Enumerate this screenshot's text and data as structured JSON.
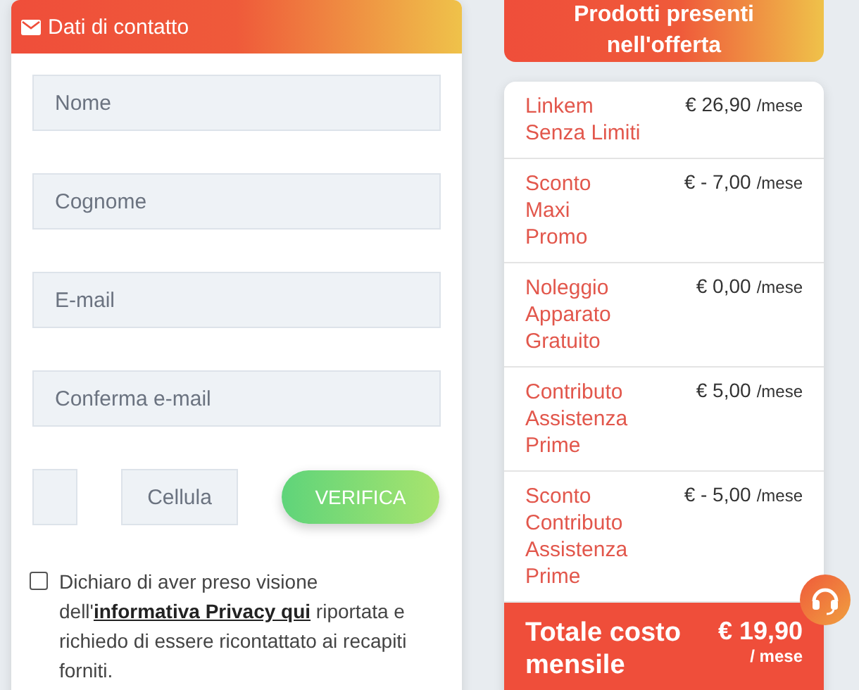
{
  "contact_form": {
    "title": "Dati di contatto",
    "fields": [
      {
        "placeholder": "Nome"
      },
      {
        "placeholder": "Cognome"
      },
      {
        "placeholder": "E-mail"
      },
      {
        "placeholder": "Conferma e-mail"
      }
    ],
    "phone": {
      "number_placeholder": "Cellula",
      "verify_button": "VERIFICA"
    },
    "consent": {
      "checked": false,
      "before": "Dichiaro di aver preso visione dell'",
      "link": "informativa Privacy qui",
      "after": " riportata e richiedo di essere ricontattato ai recapiti forniti."
    }
  },
  "offer": {
    "title": "Prodotti presenti\nnell'offerta",
    "items": [
      {
        "name": "Linkem\nSenza Limiti",
        "price": "€ 26,90",
        "unit": "/mese"
      },
      {
        "name": "Sconto\nMaxi\nPromo",
        "price": "€ - 7,00",
        "unit": "/mese"
      },
      {
        "name": "Noleggio\nApparato\nGratuito",
        "price": "€ 0,00",
        "unit": "/mese"
      },
      {
        "name": "Contributo\nAssistenza\nPrime",
        "price": "€ 5,00",
        "unit": "/mese"
      },
      {
        "name": "Sconto\nContributo\nAssistenza\nPrime",
        "price": "€ - 5,00",
        "unit": "/mese"
      }
    ],
    "total": {
      "label": "Totale costo\nmensile",
      "price": "€ 19,90",
      "unit": "/ mese"
    }
  }
}
